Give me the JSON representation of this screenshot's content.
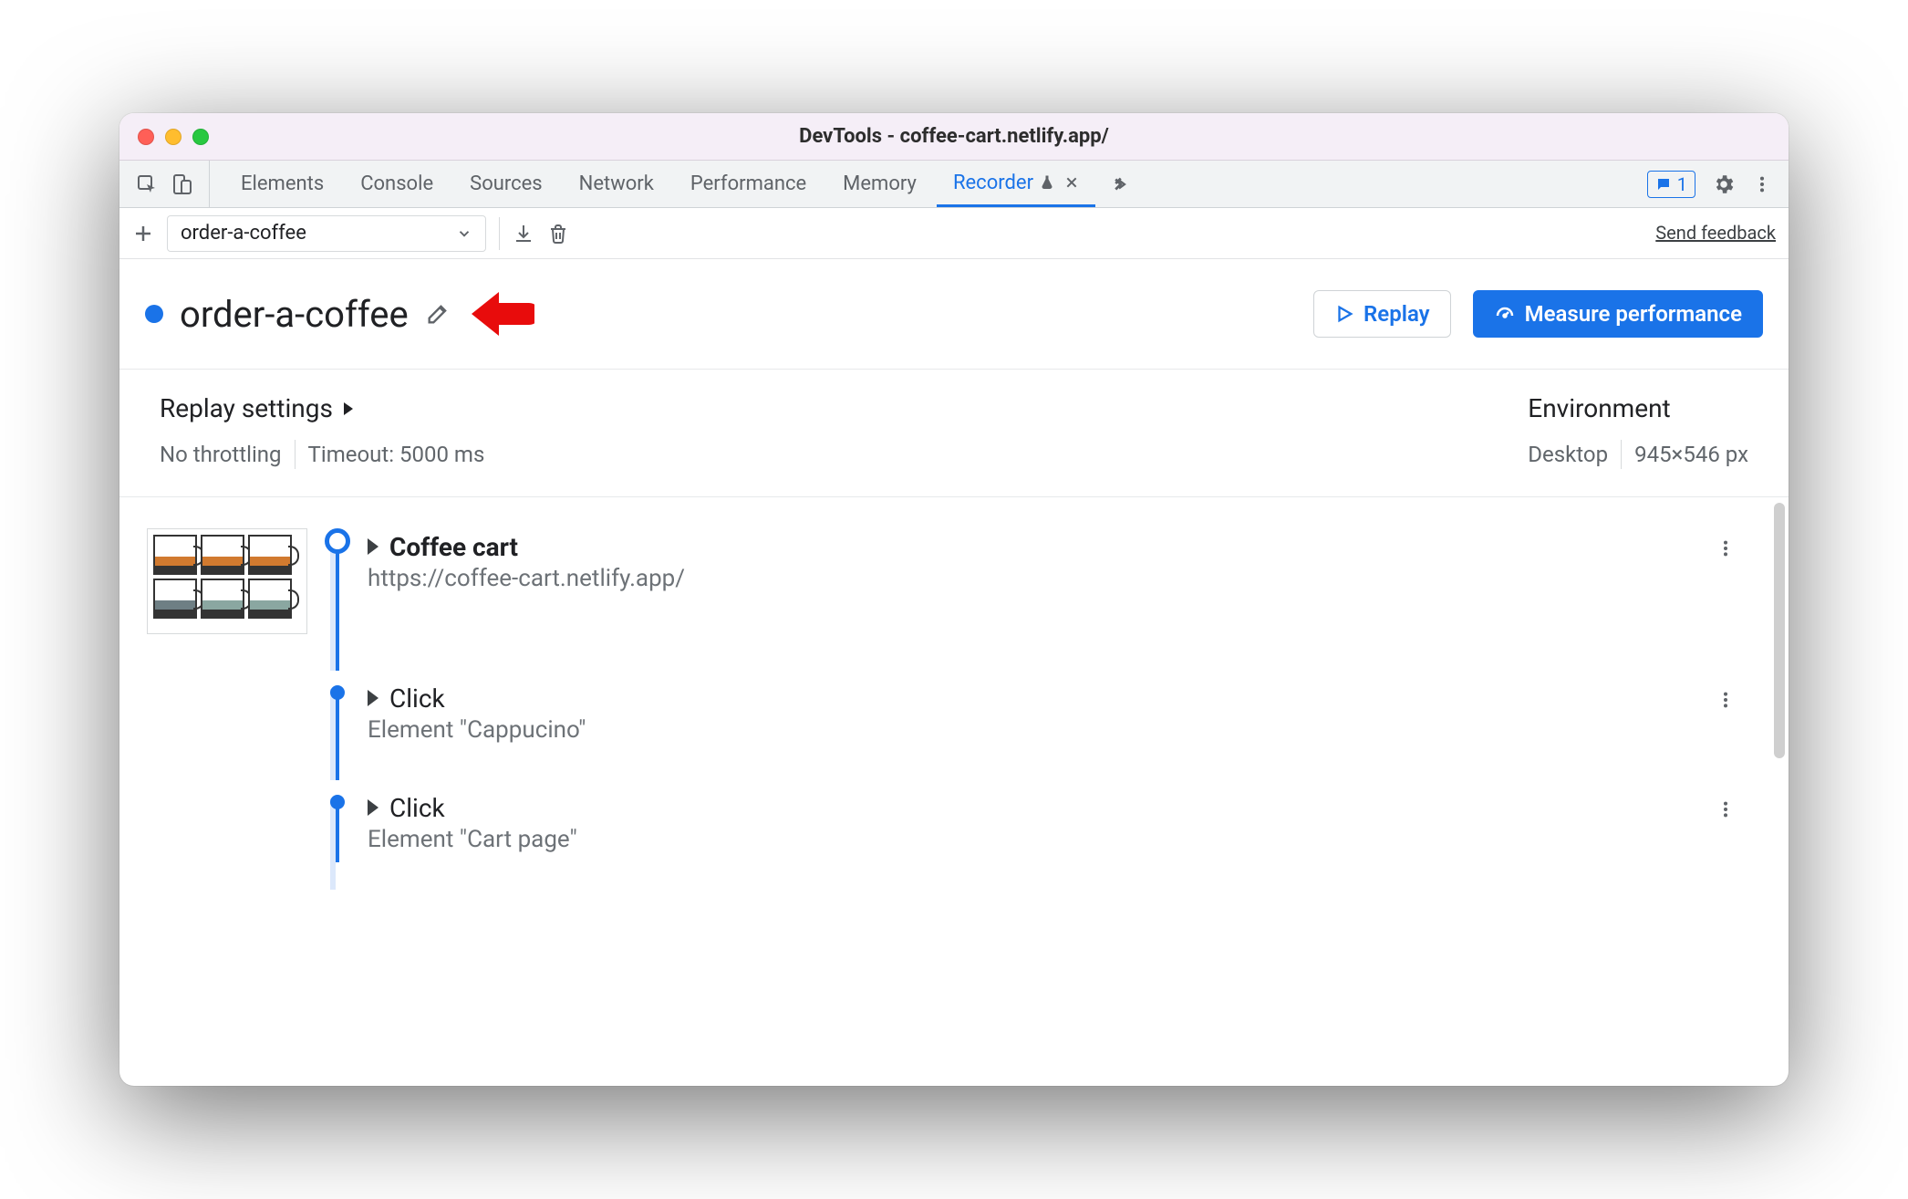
{
  "window": {
    "title": "DevTools - coffee-cart.netlify.app/"
  },
  "tabs": {
    "items": [
      {
        "label": "Elements"
      },
      {
        "label": "Console"
      },
      {
        "label": "Sources"
      },
      {
        "label": "Network"
      },
      {
        "label": "Performance"
      },
      {
        "label": "Memory"
      },
      {
        "label": "Recorder",
        "active": true
      }
    ],
    "issues_count": "1"
  },
  "toolbar": {
    "recording_select": "order-a-coffee",
    "send_feedback": "Send feedback"
  },
  "header": {
    "recording_title": "order-a-coffee",
    "replay_label": "Replay",
    "measure_label": "Measure performance"
  },
  "settings": {
    "replay_title": "Replay settings",
    "throttling": "No throttling",
    "timeout": "Timeout: 5000 ms",
    "env_title": "Environment",
    "device": "Desktop",
    "viewport": "945×546 px"
  },
  "steps": [
    {
      "kind": "initial",
      "title": "Coffee cart",
      "subtitle": "https://coffee-cart.netlify.app/"
    },
    {
      "kind": "click",
      "title": "Click",
      "subtitle": "Element \"Cappucino\""
    },
    {
      "kind": "click",
      "title": "Click",
      "subtitle": "Element \"Cart page\""
    }
  ]
}
